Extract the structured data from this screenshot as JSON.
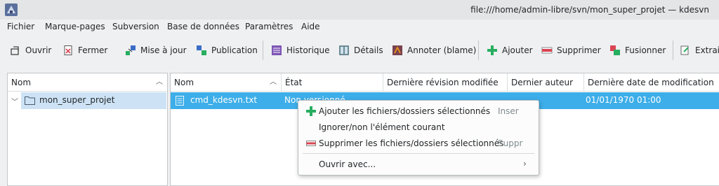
{
  "window": {
    "title": "file:///home/admin-libre/svn/mon_super_projet — kdesvn",
    "app_icon": "kdesvn-icon"
  },
  "menubar": [
    "Fichier",
    "Marque-pages",
    "Subversion",
    "Base de données",
    "Paramètres",
    "Aide"
  ],
  "toolbar": {
    "open": "Ouvrir",
    "close": "Fermer",
    "update": "Mise à jour",
    "commit": "Publication",
    "history": "Historique",
    "details": "Détails",
    "blame": "Annoter (blame)",
    "add": "Ajouter",
    "delete": "Supprimer",
    "merge": "Fusionner",
    "export": "Extrai"
  },
  "tree": {
    "header": "Nom",
    "item": "mon_super_projet"
  },
  "list": {
    "headers": [
      "Nom",
      "État",
      "Dernière révision modifiée",
      "Dernier auteur",
      "Dernière date de modification"
    ],
    "row": {
      "name": "cmd_kdesvn.txt",
      "state": "Non versionné",
      "date": "01/01/1970 01:00"
    }
  },
  "context_menu": {
    "add": "Ajouter les fichiers/dossiers sélectionnés",
    "add_shortcut": "Inser",
    "ignore": "Ignorer/non l'élément courant",
    "delete": "Supprimer les fichiers/dossiers sélectionnés",
    "delete_shortcut": "Suppr",
    "open_with": "Ouvrir avec..."
  }
}
